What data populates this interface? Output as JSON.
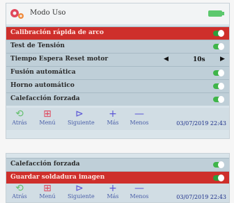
{
  "header": {
    "title": "Modo Uso"
  },
  "menu": {
    "items": [
      {
        "label": "Calibración rápida de arco"
      },
      {
        "label": "Test de Tensión"
      },
      {
        "label": "Tiempo Espera Reset motor",
        "value": "10s"
      },
      {
        "label": "Fusión automática"
      },
      {
        "label": "Horno automático"
      },
      {
        "label": "Calefacción forzada"
      }
    ]
  },
  "footer": {
    "atras": "Atrás",
    "menu": "Menú",
    "siguiente": "Siguiente",
    "mas": "Más",
    "menos": "Menos",
    "timestamp": "03/07/2019 22:43"
  },
  "second": {
    "items": [
      {
        "label": "Calefacción forzada"
      },
      {
        "label": "Guardar soldadura imagen"
      }
    ]
  },
  "icons": {
    "back": "back-arrow-icon",
    "menu": "grid-icon",
    "next": "skip-next-icon",
    "plus": "plus-icon",
    "minus": "minus-icon"
  },
  "colors": {
    "selected": "#ce2f2b",
    "toggle_on": "#3fb54a",
    "footer_icon_back": "#63c06d",
    "footer_icon_menu": "#e0475c",
    "footer_icon_blue": "#5a55d6"
  }
}
